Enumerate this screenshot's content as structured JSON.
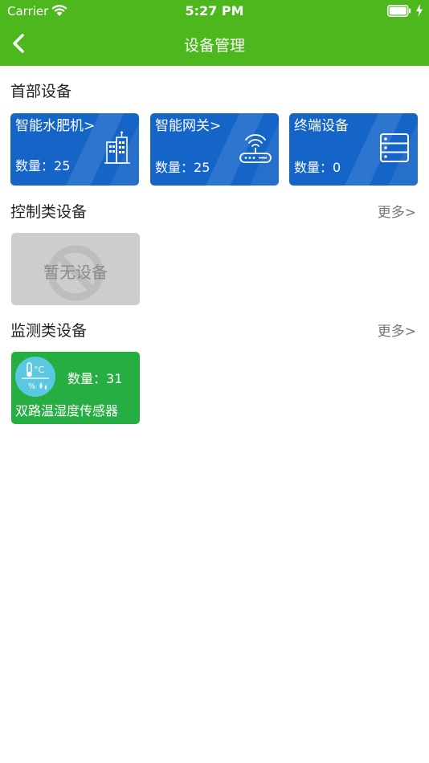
{
  "status_bar": {
    "carrier": "Carrier",
    "time": "5:27 PM"
  },
  "nav": {
    "title": "设备管理",
    "back_icon": "chevron-left-icon"
  },
  "colors": {
    "header": "#4cb81e",
    "tile_blue": "#1565c8",
    "tile_green": "#27ae43",
    "empty_tile": "#cdcdcd"
  },
  "header_section": {
    "title": "首部设备",
    "tiles": [
      {
        "name": "智能水肥机>",
        "count_label": "数量：",
        "count": "25",
        "icon": "building-icon"
      },
      {
        "name": "智能网关>",
        "count_label": "数量：",
        "count": "25",
        "icon": "router-icon"
      },
      {
        "name": "终端设备",
        "count_label": "数量：",
        "count": "0",
        "icon": "server-icon"
      }
    ]
  },
  "control_section": {
    "title": "控制类设备",
    "more": "更多>",
    "empty_text": "暂无设备"
  },
  "monitor_section": {
    "title": "监测类设备",
    "more": "更多>",
    "tiles": [
      {
        "name": "双路温湿度传感器",
        "count_label": "数量：",
        "count": "31",
        "icon": "thermo-humidity-icon",
        "icon_text_temp": "°C",
        "icon_text_hum": "%"
      }
    ]
  }
}
